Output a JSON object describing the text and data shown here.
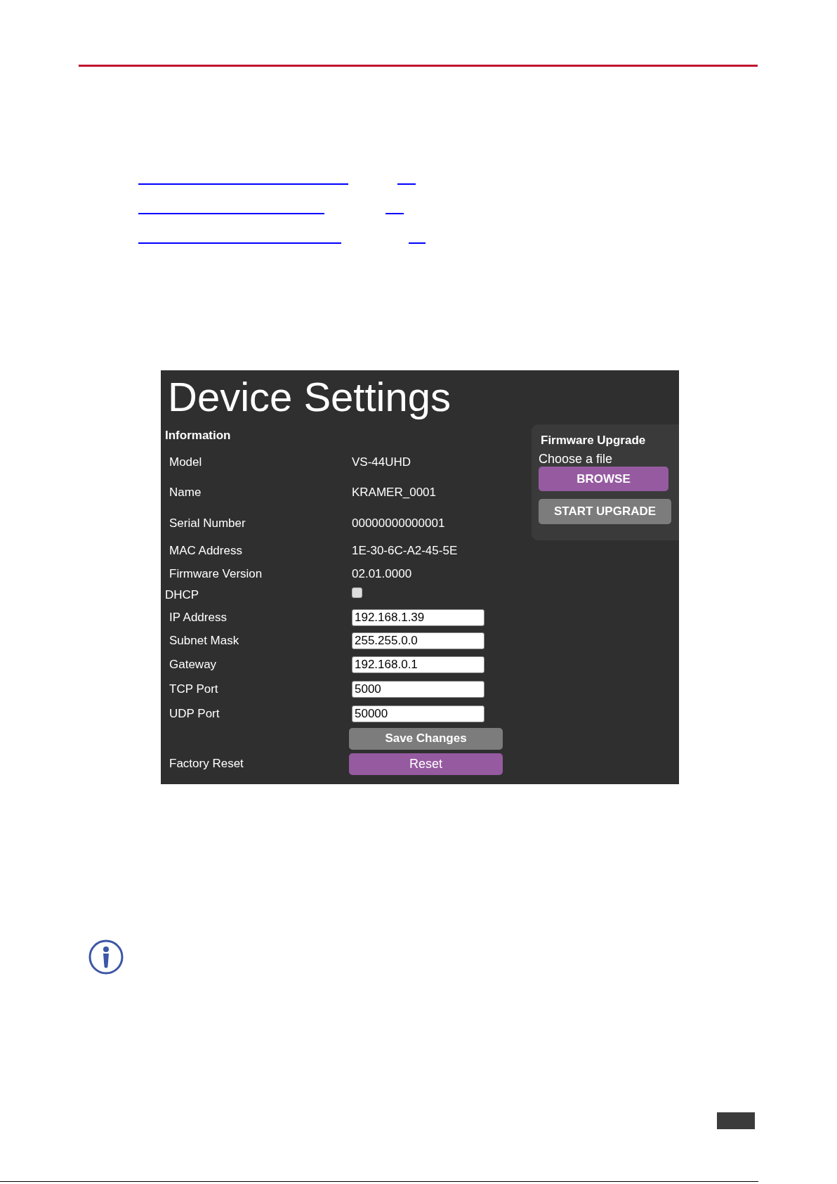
{
  "panel": {
    "title": "Device Settings",
    "information": {
      "heading": "Information",
      "rows": [
        {
          "label": "Model",
          "value": "VS-44UHD"
        },
        {
          "label": "Name",
          "value": "KRAMER_0001"
        },
        {
          "label": "Serial Number",
          "value": "00000000000001"
        },
        {
          "label": "MAC Address",
          "value": "1E-30-6C-A2-45-5E"
        },
        {
          "label": "Firmware Version",
          "value": "02.01.0000"
        }
      ]
    },
    "dhcp": {
      "label": "DHCP",
      "checked": false
    },
    "fields": [
      {
        "label": "IP Address",
        "value": "192.168.1.39"
      },
      {
        "label": "Subnet Mask",
        "value": "255.255.0.0"
      },
      {
        "label": "Gateway",
        "value": "192.168.0.1"
      },
      {
        "label": "TCP Port",
        "value": "5000"
      },
      {
        "label": "UDP Port",
        "value": "50000"
      }
    ],
    "save_button": "Save Changes",
    "factory_reset": {
      "label": "Factory Reset",
      "button": "Reset"
    },
    "firmware_upgrade": {
      "heading": "Firmware Upgrade",
      "prompt": "Choose a file",
      "browse_button": "BROWSE",
      "start_button": "START UPGRADE"
    }
  }
}
